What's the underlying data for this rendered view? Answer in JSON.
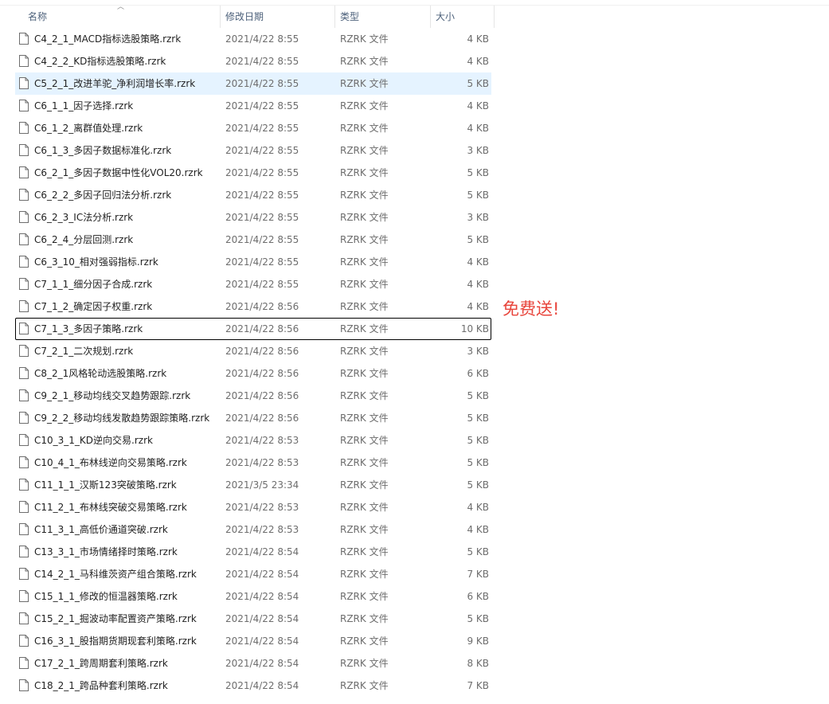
{
  "columns": {
    "name": "名称",
    "date": "修改日期",
    "type": "类型",
    "size": "大小"
  },
  "annotation": "免费送!",
  "files": [
    {
      "name": "C4_2_1_MACD指标选股策略.rzrk",
      "date": "2021/4/22 8:55",
      "type": "RZRK 文件",
      "size": "4 KB"
    },
    {
      "name": "C4_2_2_KD指标选股策略.rzrk",
      "date": "2021/4/22 8:55",
      "type": "RZRK 文件",
      "size": "4 KB"
    },
    {
      "name": "C5_2_1_改进羊驼_净利润增长率.rzrk",
      "date": "2021/4/22 8:55",
      "type": "RZRK 文件",
      "size": "5 KB",
      "hover": true
    },
    {
      "name": "C6_1_1_因子选择.rzrk",
      "date": "2021/4/22 8:55",
      "type": "RZRK 文件",
      "size": "4 KB"
    },
    {
      "name": "C6_1_2_离群值处理.rzrk",
      "date": "2021/4/22 8:55",
      "type": "RZRK 文件",
      "size": "4 KB"
    },
    {
      "name": "C6_1_3_多因子数据标准化.rzrk",
      "date": "2021/4/22 8:55",
      "type": "RZRK 文件",
      "size": "3 KB"
    },
    {
      "name": "C6_2_1_多因子数据中性化VOL20.rzrk",
      "date": "2021/4/22 8:55",
      "type": "RZRK 文件",
      "size": "5 KB"
    },
    {
      "name": "C6_2_2_多因子回归法分析.rzrk",
      "date": "2021/4/22 8:55",
      "type": "RZRK 文件",
      "size": "5 KB"
    },
    {
      "name": "C6_2_3_IC法分析.rzrk",
      "date": "2021/4/22 8:55",
      "type": "RZRK 文件",
      "size": "3 KB"
    },
    {
      "name": "C6_2_4_分层回测.rzrk",
      "date": "2021/4/22 8:55",
      "type": "RZRK 文件",
      "size": "5 KB"
    },
    {
      "name": "C6_3_10_相对强弱指标.rzrk",
      "date": "2021/4/22 8:55",
      "type": "RZRK 文件",
      "size": "4 KB"
    },
    {
      "name": "C7_1_1_细分因子合成.rzrk",
      "date": "2021/4/22 8:55",
      "type": "RZRK 文件",
      "size": "4 KB"
    },
    {
      "name": "C7_1_2_确定因子权重.rzrk",
      "date": "2021/4/22 8:56",
      "type": "RZRK 文件",
      "size": "4 KB"
    },
    {
      "name": "C7_1_3_多因子策略.rzrk",
      "date": "2021/4/22 8:56",
      "type": "RZRK 文件",
      "size": "10 KB",
      "focused": true
    },
    {
      "name": "C7_2_1_二次规划.rzrk",
      "date": "2021/4/22 8:56",
      "type": "RZRK 文件",
      "size": "3 KB"
    },
    {
      "name": "C8_2_1风格轮动选股策略.rzrk",
      "date": "2021/4/22 8:56",
      "type": "RZRK 文件",
      "size": "6 KB"
    },
    {
      "name": "C9_2_1_移动均线交叉趋势跟踪.rzrk",
      "date": "2021/4/22 8:56",
      "type": "RZRK 文件",
      "size": "5 KB"
    },
    {
      "name": "C9_2_2_移动均线发散趋势跟踪策略.rzrk",
      "date": "2021/4/22 8:56",
      "type": "RZRK 文件",
      "size": "5 KB"
    },
    {
      "name": "C10_3_1_KD逆向交易.rzrk",
      "date": "2021/4/22 8:53",
      "type": "RZRK 文件",
      "size": "5 KB"
    },
    {
      "name": "C10_4_1_布林线逆向交易策略.rzrk",
      "date": "2021/4/22 8:53",
      "type": "RZRK 文件",
      "size": "5 KB"
    },
    {
      "name": "C11_1_1_汉斯123突破策略.rzrk",
      "date": "2021/3/5 23:34",
      "type": "RZRK 文件",
      "size": "5 KB"
    },
    {
      "name": "C11_2_1_布林线突破交易策略.rzrk",
      "date": "2021/4/22 8:53",
      "type": "RZRK 文件",
      "size": "4 KB"
    },
    {
      "name": "C11_3_1_高低价通道突破.rzrk",
      "date": "2021/4/22 8:53",
      "type": "RZRK 文件",
      "size": "4 KB"
    },
    {
      "name": "C13_3_1_市场情绪择时策略.rzrk",
      "date": "2021/4/22 8:54",
      "type": "RZRK 文件",
      "size": "5 KB"
    },
    {
      "name": "C14_2_1_马科维茨资产组合策略.rzrk",
      "date": "2021/4/22 8:54",
      "type": "RZRK 文件",
      "size": "7 KB"
    },
    {
      "name": "C15_1_1_修改的恒温器策略.rzrk",
      "date": "2021/4/22 8:54",
      "type": "RZRK 文件",
      "size": "6 KB"
    },
    {
      "name": "C15_2_1_掘波动率配置资产策略.rzrk",
      "date": "2021/4/22 8:54",
      "type": "RZRK 文件",
      "size": "5 KB"
    },
    {
      "name": "C16_3_1_股指期货期现套利策略.rzrk",
      "date": "2021/4/22 8:54",
      "type": "RZRK 文件",
      "size": "9 KB"
    },
    {
      "name": "C17_2_1_跨周期套利策略.rzrk",
      "date": "2021/4/22 8:54",
      "type": "RZRK 文件",
      "size": "8 KB"
    },
    {
      "name": "C18_2_1_跨品种套利策略.rzrk",
      "date": "2021/4/22 8:54",
      "type": "RZRK 文件",
      "size": "7 KB"
    }
  ]
}
